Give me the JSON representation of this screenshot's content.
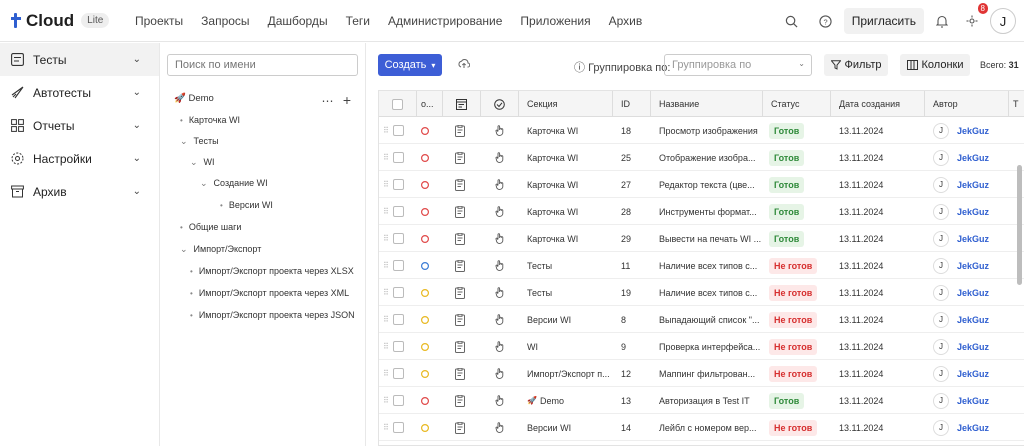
{
  "app": {
    "name": "Cloud",
    "badge": "Lite"
  },
  "nav": [
    "Проекты",
    "Запросы",
    "Дашборды",
    "Теги",
    "Администрирование",
    "Приложения",
    "Архив"
  ],
  "top": {
    "invite": "Пригласить",
    "notifications": "8",
    "user_initial": "J"
  },
  "sidebar": [
    {
      "label": "Тесты",
      "icon": "list-icon"
    },
    {
      "label": "Автотесты",
      "icon": "rocket-icon"
    },
    {
      "label": "Отчеты",
      "icon": "grid-icon"
    },
    {
      "label": "Настройки",
      "icon": "gear-icon"
    },
    {
      "label": "Архив",
      "icon": "archive-icon"
    }
  ],
  "tree": {
    "search_placeholder": "Поиск по имени",
    "root": "Demo",
    "items": [
      {
        "label": "Карточка WI",
        "type": "dot"
      },
      {
        "label": "Тесты",
        "type": "chevron"
      },
      {
        "label": "WI",
        "type": "chevron"
      },
      {
        "label": "Создание WI",
        "type": "chevron"
      },
      {
        "label": "Версии WI",
        "type": "dot"
      },
      {
        "label": "Общие шаги",
        "type": "dot"
      },
      {
        "label": "Импорт/Экспорт",
        "type": "chevron"
      },
      {
        "label": "Импорт/Экспорт проекта через XLSX",
        "type": "dot"
      },
      {
        "label": "Импорт/Экспорт проекта через XML",
        "type": "dot"
      },
      {
        "label": "Импорт/Экспорт проекта через JSON",
        "type": "dot"
      }
    ]
  },
  "toolbar": {
    "create": "Создать",
    "grouping_label": "Группировка по:",
    "grouping_placeholder": "Группировка по",
    "filter": "Фильтр",
    "columns": "Колонки",
    "total_label": "Всего:",
    "total_value": "31"
  },
  "table": {
    "headers": {
      "priority": "о...",
      "section": "Секция",
      "id": "ID",
      "name": "Название",
      "status": "Статус",
      "created": "Дата создания",
      "author": "Автор",
      "extra": "Т"
    },
    "rows": [
      {
        "section": "Карточка WI",
        "id": "18",
        "name": "Просмотр изображения",
        "status": "Готов",
        "ok": true,
        "date": "13.11.2024",
        "author": "JekGuz",
        "prio": "red"
      },
      {
        "section": "Карточка WI",
        "id": "25",
        "name": "Отображение изобра...",
        "status": "Готов",
        "ok": true,
        "date": "13.11.2024",
        "author": "JekGuz",
        "prio": "red"
      },
      {
        "section": "Карточка WI",
        "id": "27",
        "name": "Редактор текста (цве...",
        "status": "Готов",
        "ok": true,
        "date": "13.11.2024",
        "author": "JekGuz",
        "prio": "red"
      },
      {
        "section": "Карточка WI",
        "id": "28",
        "name": "Инструменты формат...",
        "status": "Готов",
        "ok": true,
        "date": "13.11.2024",
        "author": "JekGuz",
        "prio": "red"
      },
      {
        "section": "Карточка WI",
        "id": "29",
        "name": "Вывести на печать WI ...",
        "status": "Готов",
        "ok": true,
        "date": "13.11.2024",
        "author": "JekGuz",
        "prio": "red"
      },
      {
        "section": "Тесты",
        "id": "11",
        "name": "Наличие всех типов с...",
        "status": "Не готов",
        "ok": false,
        "date": "13.11.2024",
        "author": "JekGuz",
        "prio": "blue"
      },
      {
        "section": "Тесты",
        "id": "19",
        "name": "Наличие всех типов с...",
        "status": "Не готов",
        "ok": false,
        "date": "13.11.2024",
        "author": "JekGuz",
        "prio": "yellow"
      },
      {
        "section": "Версии WI",
        "id": "8",
        "name": "Выпадающий список \"...",
        "status": "Не готов",
        "ok": false,
        "date": "13.11.2024",
        "author": "JekGuz",
        "prio": "yellow"
      },
      {
        "section": "WI",
        "id": "9",
        "name": "Проверка интерфейса...",
        "status": "Не готов",
        "ok": false,
        "date": "13.11.2024",
        "author": "JekGuz",
        "prio": "yellow"
      },
      {
        "section": "Импорт/Экспорт п...",
        "id": "12",
        "name": "Маппинг фильтрован...",
        "status": "Не готов",
        "ok": false,
        "date": "13.11.2024",
        "author": "JekGuz",
        "prio": "yellow"
      },
      {
        "section": "Demo",
        "id": "13",
        "name": "Авторизация в Test IT",
        "status": "Готов",
        "ok": true,
        "date": "13.11.2024",
        "author": "JekGuz",
        "prio": "red",
        "section_icon": true
      },
      {
        "section": "Версии WI",
        "id": "14",
        "name": "Лейбл с номером вер...",
        "status": "Не готов",
        "ok": false,
        "date": "13.11.2024",
        "author": "JekGuz",
        "prio": "yellow"
      }
    ]
  },
  "colors": {
    "accent": "#3d5ed6",
    "ok_bg": "#e6f4e6",
    "ok_fg": "#2f8a3a",
    "no_bg": "#fde8e8",
    "no_fg": "#d62f2f",
    "prio_red": "#e04848",
    "prio_blue": "#3a7bd5",
    "prio_yellow": "#e8b820"
  }
}
